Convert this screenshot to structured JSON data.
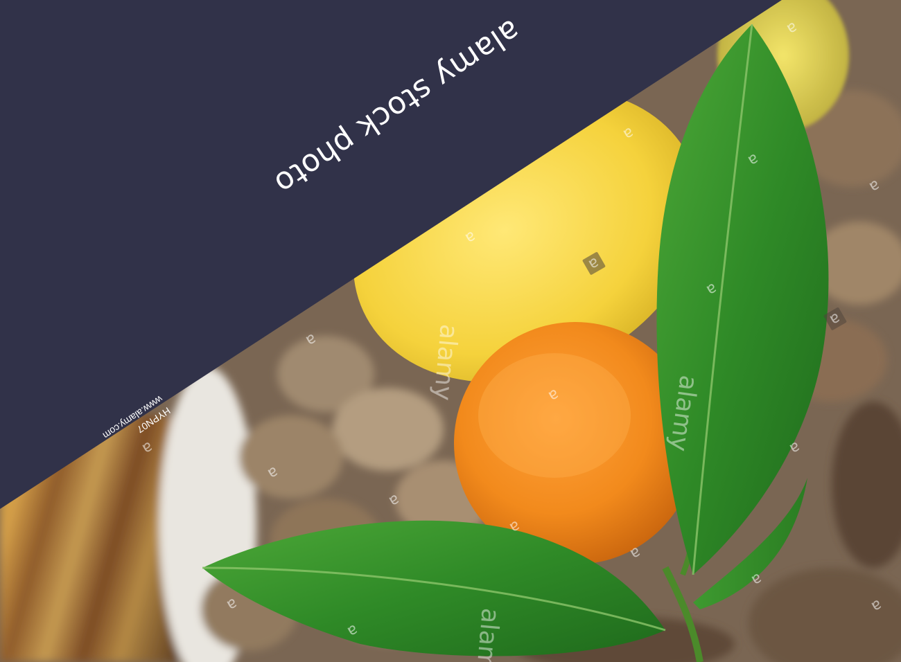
{
  "banner": {
    "text": "alamy stock photo",
    "background": "#313249"
  },
  "image_info": {
    "image_id": "HYPN07",
    "site": "www.alamy.com"
  },
  "watermark": {
    "letter": "a",
    "word": "alamy"
  },
  "photo": {
    "subject": [
      "orange",
      "lemon",
      "green-leaves",
      "walnuts"
    ]
  }
}
